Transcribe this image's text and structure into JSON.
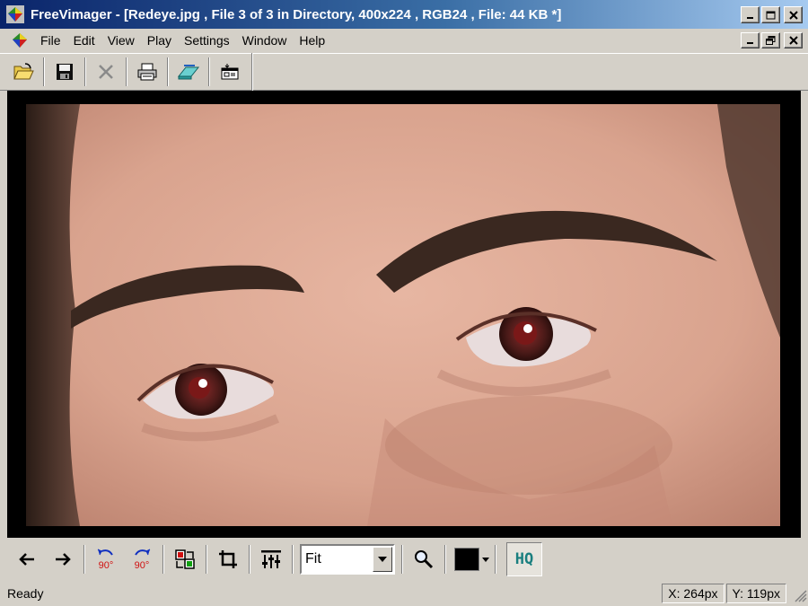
{
  "window": {
    "title": "FreeVimager - [Redeye.jpg , File 3 of 3 in Directory, 400x224 , RGB24 , File: 44 KB *]",
    "minimize_label": "_",
    "maximize_label": "□",
    "close_label": "✕"
  },
  "menu": {
    "items": [
      "File",
      "Edit",
      "View",
      "Play",
      "Settings",
      "Window",
      "Help"
    ]
  },
  "toolbar": {
    "icons": [
      "open-folder-icon",
      "save-disk-icon",
      "delete-x-icon",
      "print-icon",
      "scanner-icon",
      "capture-icon"
    ]
  },
  "bottom_toolbar": {
    "rotate_ccw_label": "90°",
    "rotate_cw_label": "90°",
    "zoom_value": "Fit",
    "background_color": "#000000",
    "hq_label": "HQ"
  },
  "status": {
    "text": "Ready",
    "x_readout": "X: 264px",
    "y_readout": "Y: 119px"
  },
  "colors": {
    "title_gradient_start": "#0a246a",
    "title_gradient_end": "#a6caf0",
    "chrome": "#d4d0c8",
    "rotate_icon_red": "#d01010",
    "rotate_icon_blue": "#1030c0",
    "hq_teal": "#1a7f7f"
  }
}
